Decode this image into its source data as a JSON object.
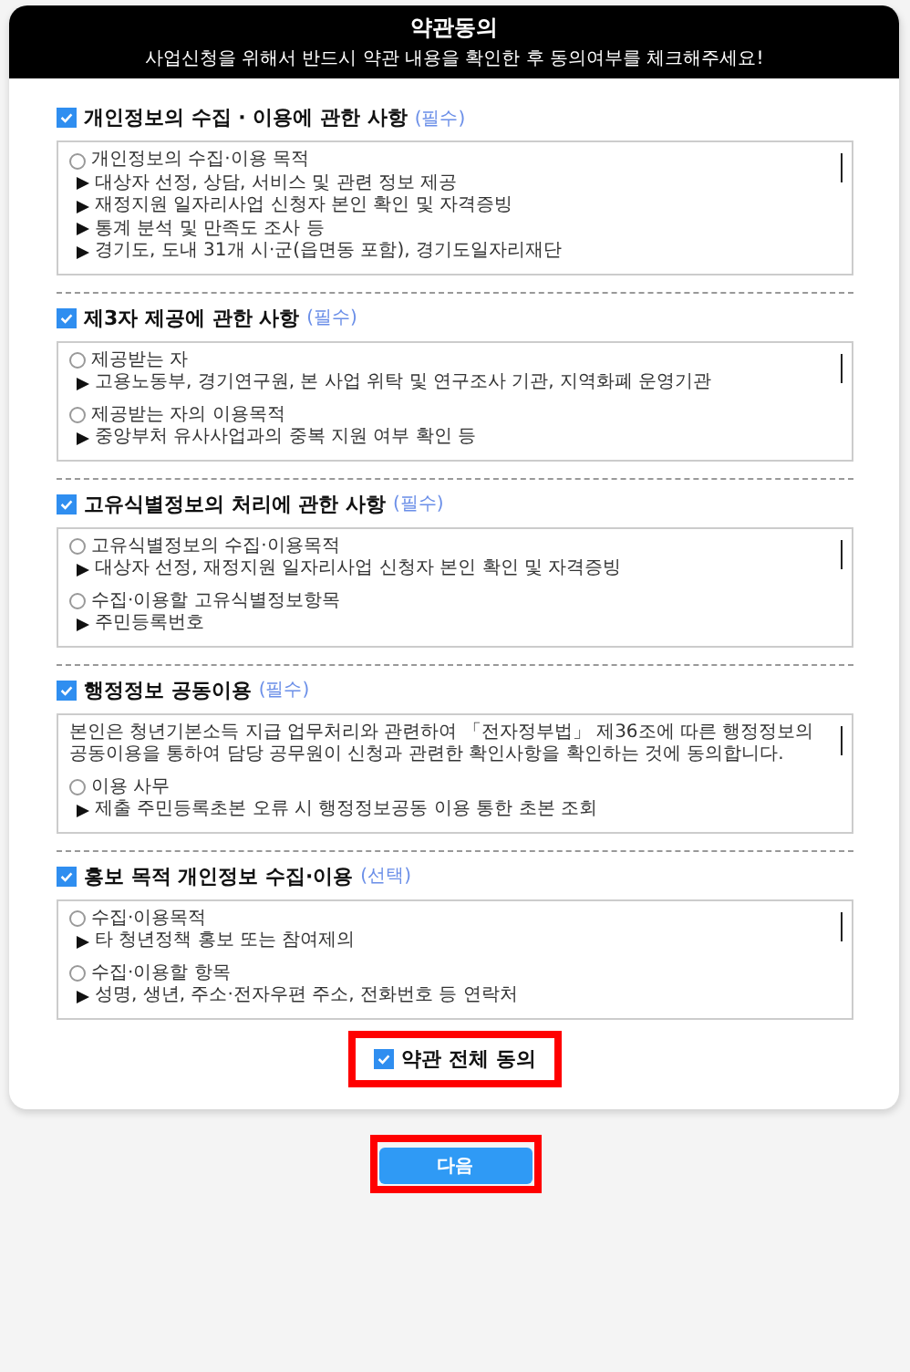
{
  "header": {
    "title": "약관동의",
    "subtitle": "사업신청을 위해서 반드시 약관 내용을 확인한 후 동의여부를 체크해주세요!"
  },
  "sections": [
    {
      "title": "개인정보의 수집 · 이용에 관한 사항",
      "tag": "(필수)",
      "checked": true,
      "lines": [
        {
          "kind": "heading",
          "text": "개인정보의 수집·이용 목적"
        },
        {
          "kind": "bullet",
          "text": "대상자 선정, 상담, 서비스 및 관련 정보 제공"
        },
        {
          "kind": "bullet",
          "text": "재정지원 일자리사업 신청자 본인 확인 및 자격증빙"
        },
        {
          "kind": "bullet",
          "text": "통계 분석 및 만족도 조사 등"
        },
        {
          "kind": "bullet",
          "text": "경기도, 도내 31개 시·군(읍면동 포함), 경기도일자리재단"
        }
      ]
    },
    {
      "title": "제3자 제공에 관한 사항",
      "tag": "(필수)",
      "checked": true,
      "lines": [
        {
          "kind": "heading",
          "text": "제공받는 자"
        },
        {
          "kind": "bullet",
          "text": "고용노동부, 경기연구원, 본 사업 위탁 및 연구조사 기관, 지역화폐 운영기관"
        },
        {
          "kind": "heading",
          "text": "제공받는 자의 이용목적"
        },
        {
          "kind": "bullet",
          "text": "중앙부처 유사사업과의 중복 지원 여부 확인 등"
        }
      ]
    },
    {
      "title": "고유식별정보의 처리에 관한 사항",
      "tag": "(필수)",
      "checked": true,
      "lines": [
        {
          "kind": "heading",
          "text": "고유식별정보의 수집·이용목적"
        },
        {
          "kind": "bullet",
          "text": "대상자 선정, 재정지원 일자리사업 신청자 본인 확인 및 자격증빙"
        },
        {
          "kind": "heading",
          "text": "수집·이용할 고유식별정보항목"
        },
        {
          "kind": "bullet",
          "text": "주민등록번호"
        }
      ]
    },
    {
      "title": "행정정보 공동이용",
      "tag": "(필수)",
      "checked": true,
      "lines": [
        {
          "kind": "paragraph",
          "text": "본인은 청년기본소득 지급 업무처리와 관련하여 「전자정부법」 제36조에 따른 행정정보의 공동이용을 통하여 담당 공무원이 신청과 관련한 확인사항을 확인하는 것에 동의합니다."
        },
        {
          "kind": "heading",
          "text": "이용 사무"
        },
        {
          "kind": "bullet",
          "text": "제출 주민등록초본 오류 시 행정정보공동 이용 통한 초본 조회"
        }
      ]
    },
    {
      "title": "홍보 목적 개인정보 수집·이용",
      "tag": "(선택)",
      "checked": true,
      "lines": [
        {
          "kind": "heading",
          "text": "수집·이용목적"
        },
        {
          "kind": "bullet",
          "text": "타 청년정책 홍보 또는 참여제의"
        },
        {
          "kind": "heading",
          "text": "수집·이용할 항목"
        },
        {
          "kind": "bullet",
          "text": "성명, 생년, 주소·전자우편 주소, 전화번호 등 연락처"
        }
      ]
    }
  ],
  "agree_all": {
    "label": "약관 전체 동의",
    "checked": true
  },
  "next_button": "다음"
}
